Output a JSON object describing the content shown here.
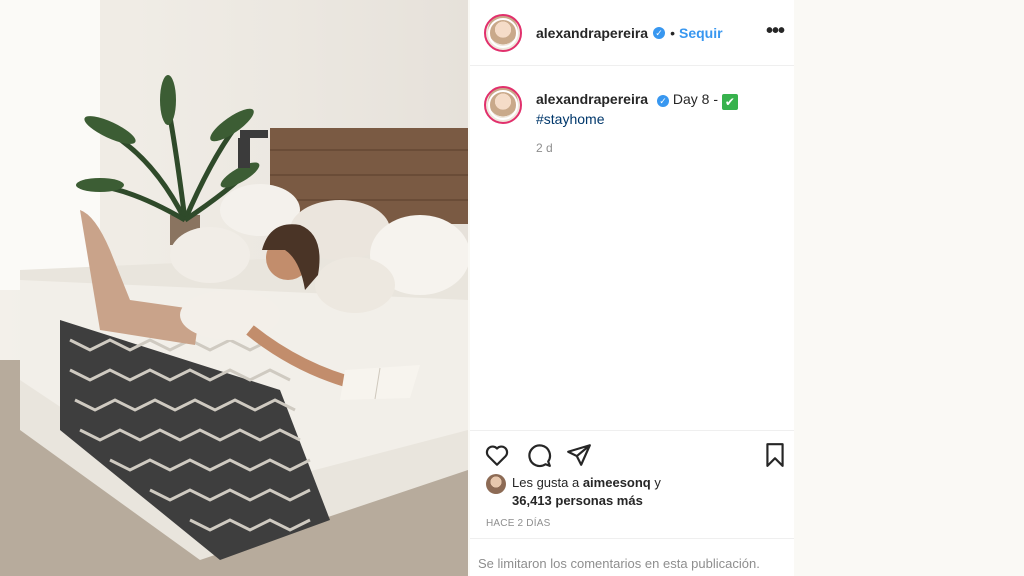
{
  "post": {
    "username": "alexandrapereira",
    "follow_label": "Sequir",
    "more_label": "•••",
    "separator": "•",
    "caption_text": "Day 8 -",
    "caption_emoji": "✔",
    "hashtag": "#stayhome",
    "caption_time": "2 d",
    "likes_prefix": "Les gusta a ",
    "likes_user": "aimeesonq",
    "likes_suffix": " y",
    "likes_count": "36,413 personas más",
    "time_ago": "HACE 2 DÍAS",
    "comments_note": "Se limitaron los comentarios en esta publicación."
  },
  "icons": {
    "like": "heart-icon",
    "comment": "comment-icon",
    "share": "send-icon",
    "save": "bookmark-icon",
    "verified": "verified-badge-icon"
  },
  "colors": {
    "accent": "#3897f0",
    "hashtag": "#00376b",
    "muted": "#8e8e8e",
    "emoji_green": "#37b24d"
  }
}
